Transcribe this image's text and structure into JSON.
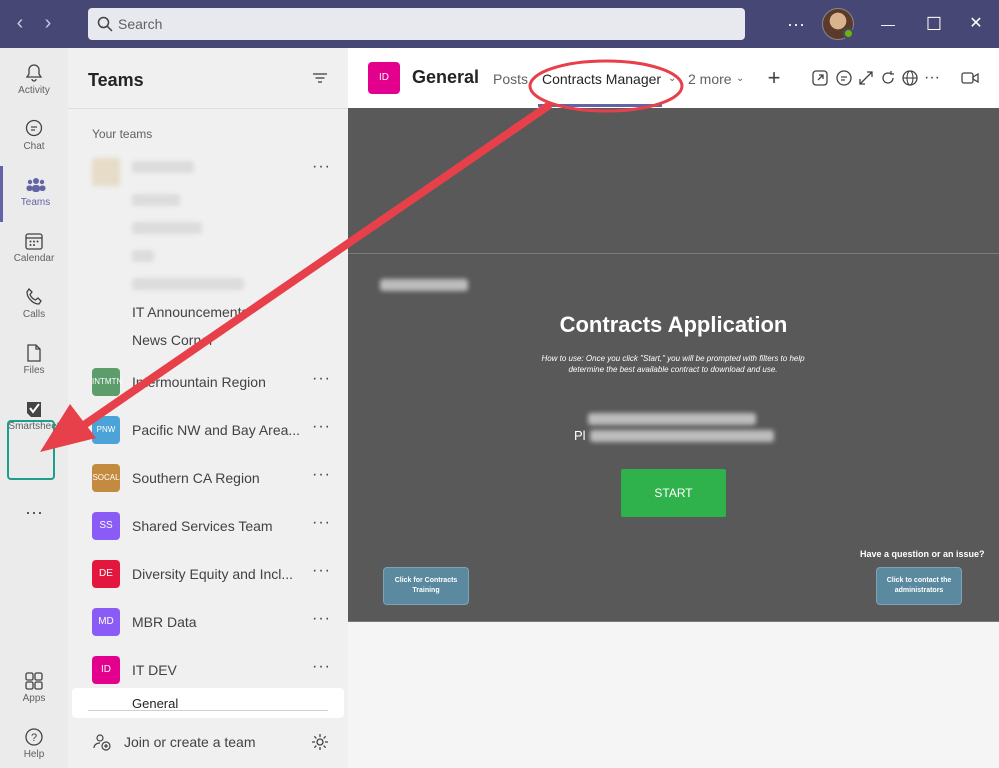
{
  "titlebar": {
    "search_placeholder": "Search",
    "more": "···",
    "minimize": "—",
    "maximize": "☐",
    "close": "✕",
    "accent": "#464775"
  },
  "rail": {
    "items": [
      {
        "label": "Activity",
        "icon": "bell-icon"
      },
      {
        "label": "Chat",
        "icon": "chat-icon"
      },
      {
        "label": "Teams",
        "icon": "teams-icon",
        "active": true
      },
      {
        "label": "Calendar",
        "icon": "calendar-icon"
      },
      {
        "label": "Calls",
        "icon": "phone-icon"
      },
      {
        "label": "Files",
        "icon": "file-icon"
      },
      {
        "label": "Smartsheet",
        "icon": "smartsheet-icon"
      }
    ],
    "more": "···",
    "apps_label": "Apps",
    "help_label": "Help"
  },
  "panel": {
    "title": "Teams",
    "your_teams": "Your teams",
    "channels": [
      "IT Announcements",
      "News Corner"
    ],
    "teams": [
      {
        "badge": "INTMTN",
        "name": "Intermountain Region",
        "color": "#5d9c6b"
      },
      {
        "badge": "PNW",
        "name": "Pacific NW and Bay Area...",
        "color": "#4ba3d8"
      },
      {
        "badge": "SOCAL",
        "name": "Southern CA Region",
        "color": "#c48a3f"
      },
      {
        "badge": "SS",
        "name": "Shared Services Team",
        "color": "#8a5cf5"
      },
      {
        "badge": "DE",
        "name": "Diversity Equity and Incl...",
        "color": "#e3173e"
      },
      {
        "badge": "MD",
        "name": "MBR Data",
        "color": "#8a5cf5"
      },
      {
        "badge": "ID",
        "name": "IT DEV",
        "color": "#e3008c"
      }
    ],
    "team_more": "···",
    "selected_channel": "General",
    "join_label": "Join or create a team"
  },
  "header": {
    "badge": "ID",
    "channel": "General",
    "tabs": [
      "Posts",
      "Contracts Manager",
      "2 more"
    ],
    "add": "+"
  },
  "app": {
    "title": "Contracts Application",
    "description": "How to use: Once you click \"Start,\" you will be prompted with filters to help determine the best available contract to download and use.",
    "partial_text": "Pl",
    "start_label": "START",
    "question": "Have a question or an issue?",
    "training_button": "Click for Contracts Training",
    "contact_button": "Click to contact the administrators",
    "start_color": "#2fb24c"
  }
}
